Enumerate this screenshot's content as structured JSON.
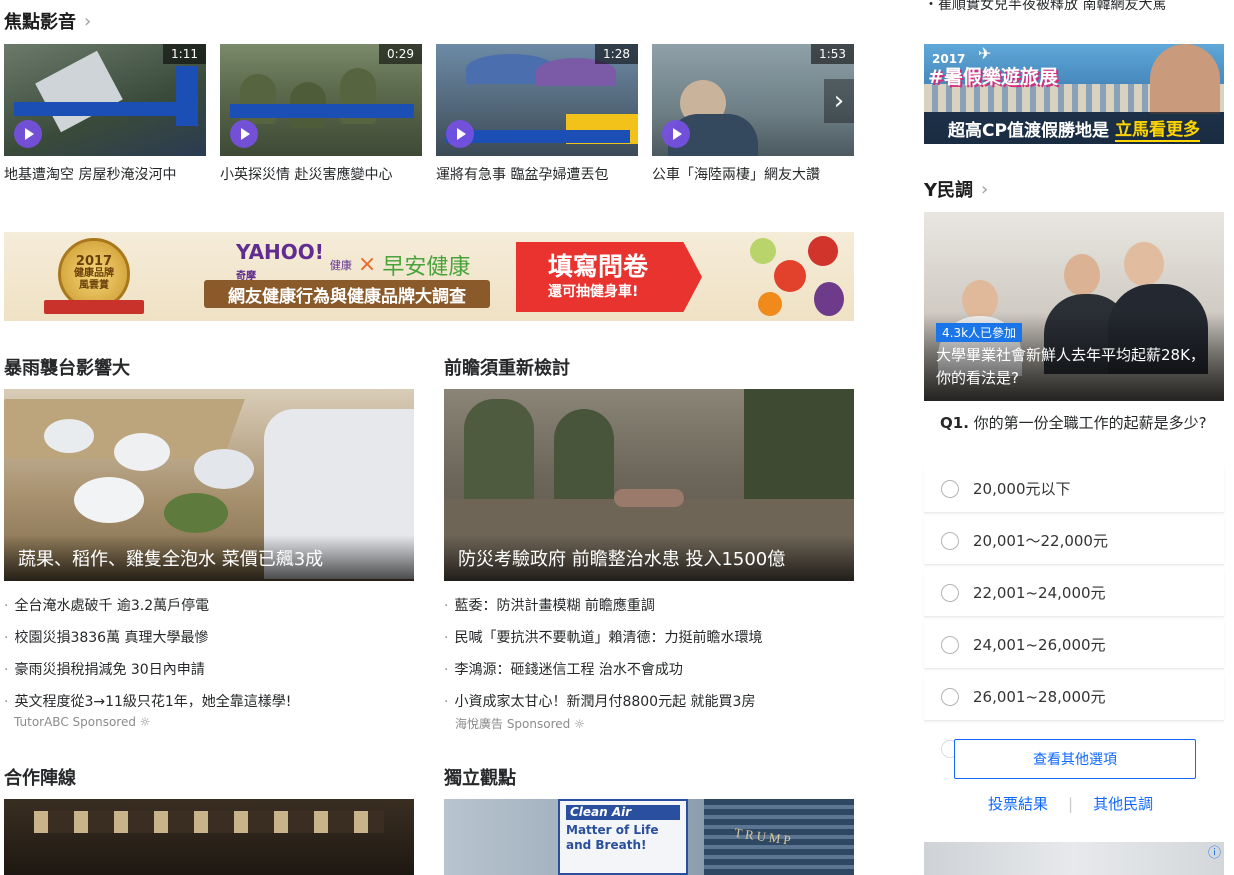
{
  "top_right_text": "・崔順實女兒半夜被釋放 南韓網友大罵",
  "focus": {
    "title": "焦點影音",
    "videos": [
      {
        "duration": "1:11",
        "caption": "地基遭淘空 房屋秒淹沒河中"
      },
      {
        "duration": "0:29",
        "caption": "小英探災情 赴災害應變中心"
      },
      {
        "duration": "1:28",
        "caption": "運將有急事 臨盆孕婦遭丟包"
      },
      {
        "duration": "1:53",
        "caption": "公車「海陸兩棲」網友大讚"
      }
    ]
  },
  "banner": {
    "badge_year": "2017",
    "badge_line1": "健康品牌",
    "badge_line2": "風雲賞",
    "yahoo": "YAHOO!",
    "yahoo_sub": "奇摩",
    "yahoo_health": "健康",
    "times": "×",
    "partner": "早安健康",
    "subtitle": "網友健康行為與健康品牌大調查",
    "cta_main": "填寫問卷",
    "cta_sub": "還可抽健身車!"
  },
  "storm": {
    "title": "暴雨襲台影響大",
    "hero_caption": "蔬果、稻作、雞隻全泡水 菜價已飆3成",
    "headlines": [
      "全台淹水處破千 逾3.2萬戶停電",
      "校園災損3836萬 真理大學最慘",
      "豪雨災損稅捐減免 30日內申請",
      "英文程度從3→11級只花1年，她全靠這樣學!"
    ],
    "sponsor": "TutorABC Sponsored"
  },
  "forward": {
    "title": "前瞻須重新檢討",
    "hero_caption": "防災考驗政府 前瞻整治水患 投入1500億",
    "headlines": [
      "藍委：防洪計畫模糊 前瞻應重調",
      "民喊「要抗洪不要軌道」賴清德：力挺前瞻水環境",
      "李鴻源：砸錢迷信工程 治水不會成功",
      "小資成家太甘心！新潤月付8800元起 就能買3房"
    ],
    "sponsor": "海悅廣告 Sponsored"
  },
  "partners": {
    "title": "合作陣線"
  },
  "opinion": {
    "title": "獨立觀點",
    "sign1": "Clean Air",
    "sign2": "Matter of Life and Breath!",
    "building": "TRUMP"
  },
  "side_ad": {
    "year": "2017",
    "title": "#暑假樂遊旅展",
    "text": "超高CP值渡假勝地是",
    "cta": "立馬看更多"
  },
  "poll": {
    "title": "Y民調",
    "participants": "4.3k人已參加",
    "question_headline": "大學畢業社會新鮮人去年平均起薪28K，你的看法是?",
    "q_label": "Q1.",
    "q_text": "你的第一份全職工作的起薪是多少?",
    "options": [
      "20,000元以下",
      "20,001～22,000元",
      "22,001~24,000元",
      "24,001~26,000元",
      "26,001~28,000元"
    ],
    "more_button": "查看其他選項",
    "results_link": "投票結果",
    "divider": "|",
    "other_link": "其他民調"
  },
  "adchoice": "ⓘ",
  "colors": {
    "accent": "#0f69ff",
    "play": "#7850e6",
    "badge_blue": "#1a75e8",
    "cta_red": "#e8332f"
  }
}
